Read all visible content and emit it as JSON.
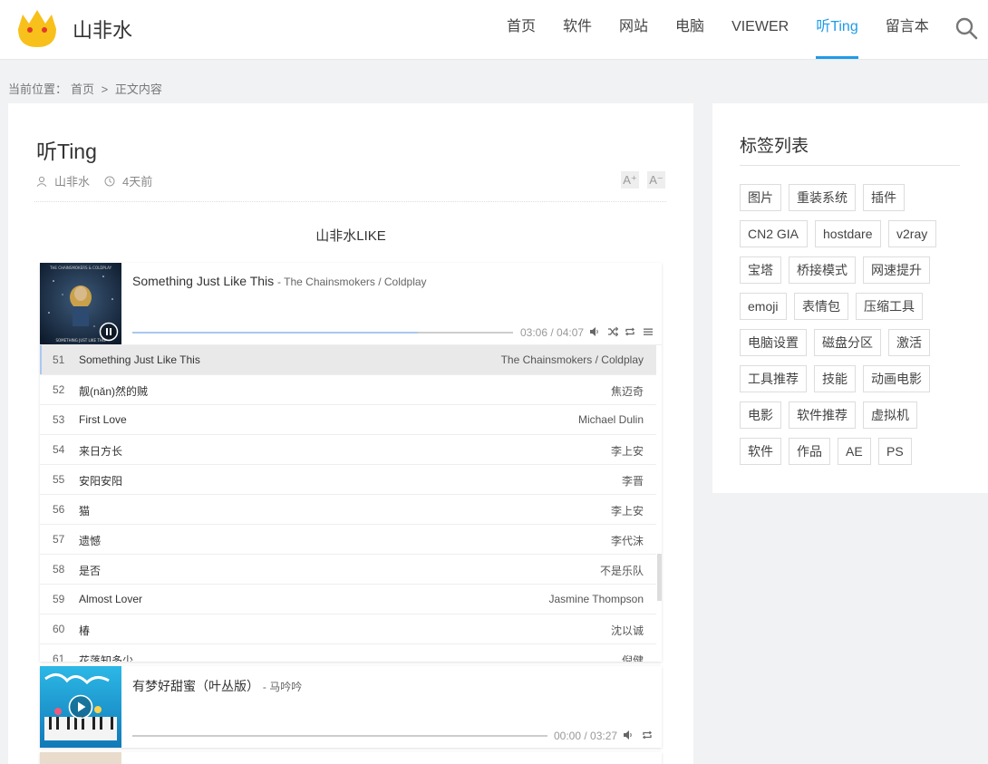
{
  "header": {
    "site_name": "山非水",
    "nav": [
      "首页",
      "软件",
      "网站",
      "电脑",
      "VIEWER",
      "听Ting",
      "留言本"
    ],
    "active_nav": "听Ting"
  },
  "breadcrumb": {
    "label": "当前位置：",
    "home": "首页",
    "sep": ">",
    "current": "正文内容"
  },
  "post": {
    "title": "听Ting",
    "author": "山非水",
    "time": "4天前",
    "font_increase": "A⁺",
    "font_decrease": "A⁻",
    "list_title": "山非水LIKE"
  },
  "player1": {
    "title": "Something Just Like This",
    "author": "- The Chainsmokers / Coldplay",
    "time": "03:06 / 04:07",
    "progress": 0.75,
    "playing": true,
    "cover_text": "THE CHAINSMOKERS & COLDPLAY",
    "cover_bottom": "SOMETHING JUST LIKE THIS",
    "playlist": [
      {
        "idx": "51",
        "title": "Something Just Like This",
        "artist": "The Chainsmokers / Coldplay",
        "active": true
      },
      {
        "idx": "52",
        "title": "靓(nǎn)然的贼",
        "artist": "焦迈奇"
      },
      {
        "idx": "53",
        "title": "First Love",
        "artist": "Michael Dulin"
      },
      {
        "idx": "54",
        "title": "来日方长",
        "artist": "李上安"
      },
      {
        "idx": "55",
        "title": "安阳安阳",
        "artist": "李晋"
      },
      {
        "idx": "56",
        "title": "猫",
        "artist": "李上安"
      },
      {
        "idx": "57",
        "title": "遗憾",
        "artist": "李代沫"
      },
      {
        "idx": "58",
        "title": "是否",
        "artist": "不是乐队"
      },
      {
        "idx": "59",
        "title": "Almost Lover",
        "artist": "Jasmine Thompson"
      },
      {
        "idx": "60",
        "title": "椿",
        "artist": "沈以诚"
      },
      {
        "idx": "61",
        "title": "花落知多少",
        "artist": "倪健"
      }
    ]
  },
  "player2": {
    "title": "有梦好甜蜜（叶丛版）",
    "author": "- 马吟吟",
    "time": "00:00 / 03:27",
    "progress": 0,
    "playing": false
  },
  "sidebar": {
    "title": "标签列表",
    "tags": [
      [
        "图片",
        "重装系统",
        "插件"
      ],
      [
        "CN2 GIA",
        "hostdare",
        "v2ray"
      ],
      [
        "宝塔",
        "桥接模式",
        "网速提升"
      ],
      [
        "emoji",
        "表情包",
        "压缩工具"
      ],
      [
        "电脑设置",
        "磁盘分区",
        "激活"
      ],
      [
        "工具推荐",
        "技能",
        "动画电影"
      ],
      [
        "电影",
        "软件推荐",
        "虚拟机"
      ],
      [
        "软件",
        "作品",
        "AE",
        "PS"
      ]
    ]
  },
  "colors": {
    "accent": "#1e9be8",
    "background": "#f1f2f4"
  },
  "icons": [
    "logo-icon",
    "search-icon",
    "user-icon",
    "clock-icon",
    "pause-icon",
    "play-icon",
    "volume-icon",
    "shuffle-icon",
    "loop-icon",
    "menu-icon"
  ]
}
